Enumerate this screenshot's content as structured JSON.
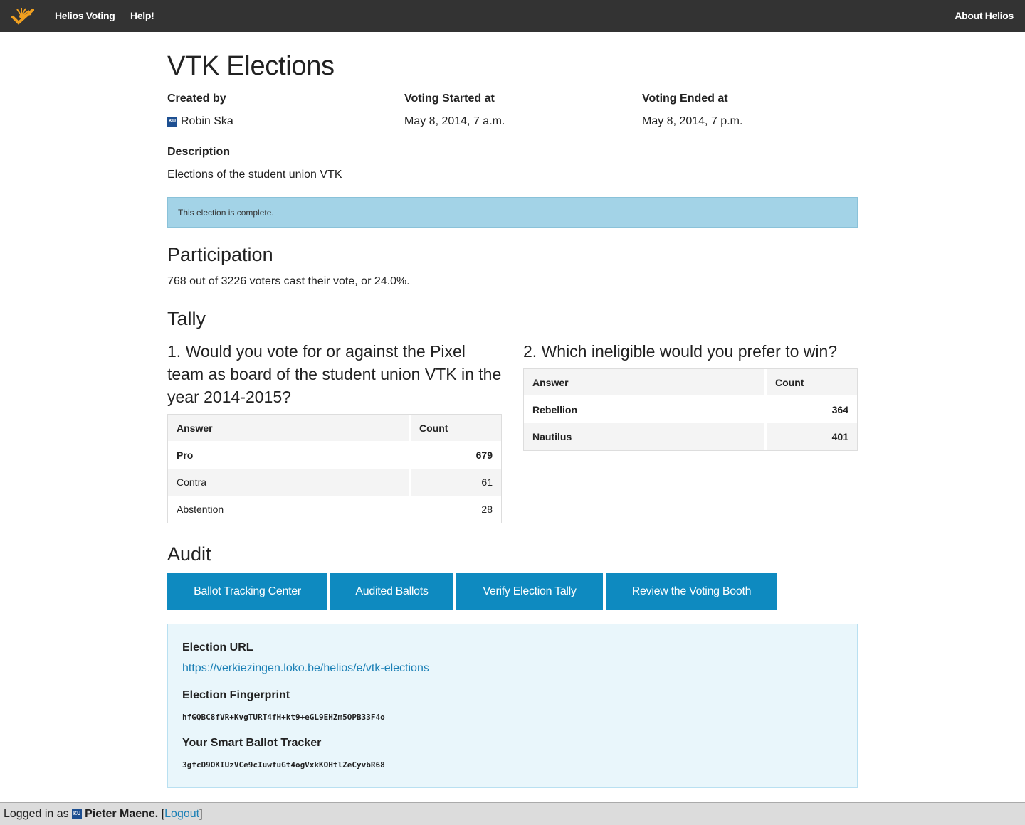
{
  "nav": {
    "home": "Helios Voting",
    "help": "Help!",
    "about": "About Helios"
  },
  "election": {
    "title": "VTK Elections",
    "created_by_label": "Created by",
    "created_by": "Robin Ska",
    "voting_started_label": "Voting Started at",
    "voting_started": "May 8, 2014, 7 a.m.",
    "voting_ended_label": "Voting Ended at",
    "voting_ended": "May 8, 2014, 7 p.m.",
    "description_label": "Description",
    "description": "Elections of the student union VTK",
    "status_alert": "This election is complete."
  },
  "participation": {
    "heading": "Participation",
    "text": "768 out of 3226 voters cast their vote, or 24.0%."
  },
  "tally": {
    "heading": "Tally",
    "questions": [
      {
        "title": "1. Would you vote for or against the Pixel team as board of the student union VTK in the year 2014-2015?",
        "answer_header": "Answer",
        "count_header": "Count",
        "rows": [
          {
            "answer": "Pro",
            "count": "679"
          },
          {
            "answer": "Contra",
            "count": "61"
          },
          {
            "answer": "Abstention",
            "count": "28"
          }
        ]
      },
      {
        "title": "2. Which ineligible would you prefer to win?",
        "answer_header": "Answer",
        "count_header": "Count",
        "rows": [
          {
            "answer": "Rebellion",
            "count": "364"
          },
          {
            "answer": "Nautilus",
            "count": "401"
          }
        ]
      }
    ]
  },
  "audit": {
    "heading": "Audit",
    "buttons": [
      "Ballot Tracking Center",
      "Audited Ballots",
      "Verify Election Tally",
      "Review the Voting Booth"
    ],
    "url_label": "Election URL",
    "url": "https://verkiezingen.loko.be/helios/e/vtk-elections",
    "fingerprint_label": "Election Fingerprint",
    "fingerprint": "hfGQBC8fVR+KvgTURT4fH+kt9+eGL9EHZm5OPB33F4o",
    "tracker_label": "Your Smart Ballot Tracker",
    "tracker": "3gfcD9OKIUzVCe9cIuwfuGt4ogVxkKOHtlZeCyvbR68"
  },
  "footer": {
    "logged_in_prefix": "Logged in as",
    "user": "Pieter Maene.",
    "logout": "Logout"
  },
  "icons": {
    "logo": "helios-logo-icon",
    "institution_badge": "ku-badge-icon",
    "badge_text": "KU"
  },
  "colors": {
    "topbar": "#333333",
    "alert": "#a3d3e7",
    "button": "#0e8ac0",
    "audit_box": "#e9f6fb",
    "link": "#1a7fb5"
  }
}
